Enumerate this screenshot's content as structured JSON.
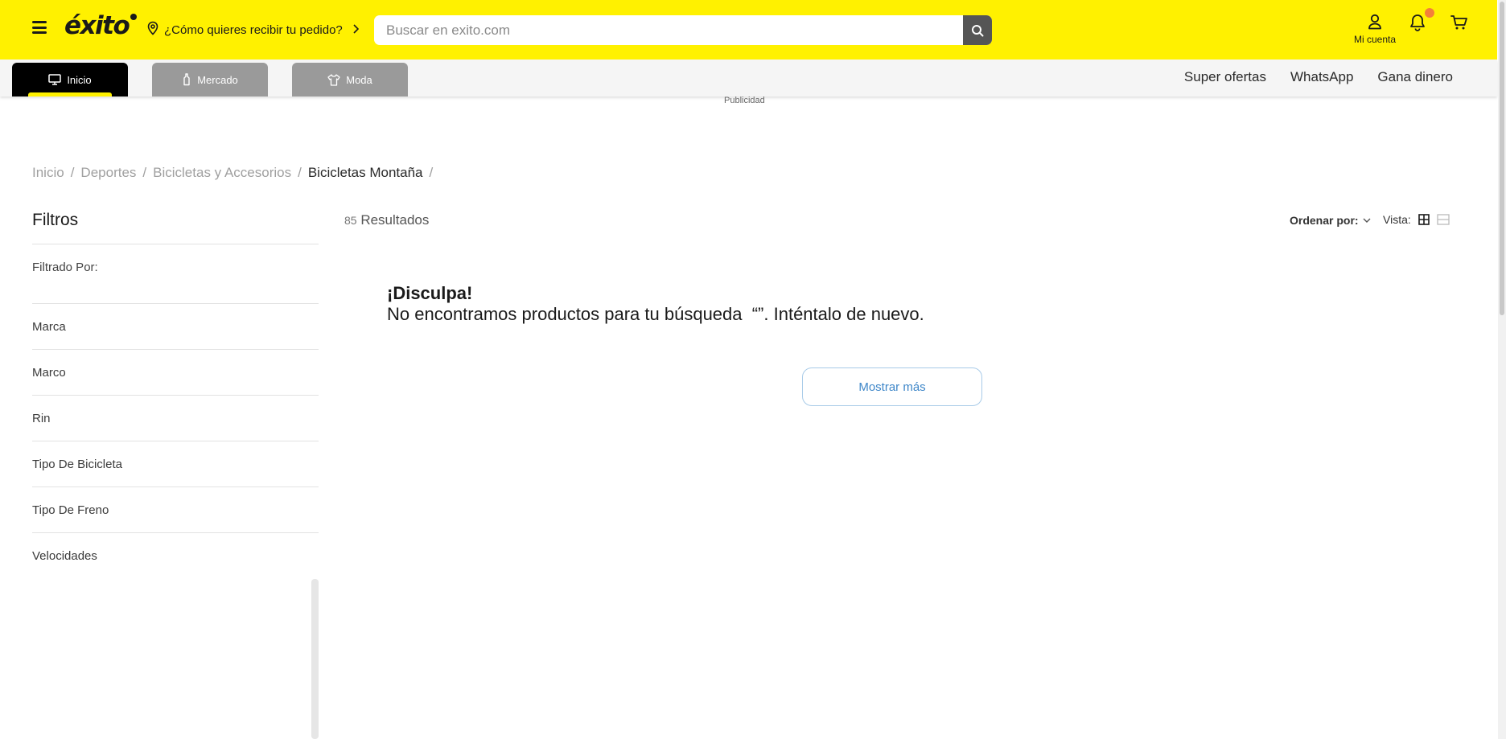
{
  "header": {
    "logo": "éxito",
    "location_prompt": "¿Cómo quieres recibir tu pedido?",
    "search_placeholder": "Buscar en exito.com",
    "account_label": "Mi cuenta",
    "brand_color": "#fff100",
    "notification_color": "#f47f3a"
  },
  "nav": {
    "tabs": [
      {
        "label": "Inicio",
        "icon": "monitor-icon",
        "active": true
      },
      {
        "label": "Mercado",
        "icon": "bottle-icon",
        "active": false
      },
      {
        "label": "Moda",
        "icon": "shirt-icon",
        "active": false
      }
    ],
    "links": [
      "Super ofertas",
      "WhatsApp",
      "Gana dinero"
    ]
  },
  "ad_label": "Publicidad",
  "breadcrumb": [
    "Inicio",
    "Deportes",
    "Bicicletas y Accesorios",
    "Bicicletas Montaña"
  ],
  "filters": {
    "title": "Filtros",
    "filtered_by": "Filtrado Por:",
    "facets": [
      "Marca",
      "Marco",
      "Rin",
      "Tipo De Bicicleta",
      "Tipo De Freno",
      "Velocidades"
    ]
  },
  "results": {
    "count": "85",
    "label": "Resultados",
    "sort_label": "Ordenar por:",
    "view_label": "Vista:"
  },
  "empty": {
    "heading": "¡Disculpa!",
    "message": "No encontramos productos para tu búsqueda  “”. Inténtalo de nuevo.",
    "show_more": "Mostrar más"
  }
}
